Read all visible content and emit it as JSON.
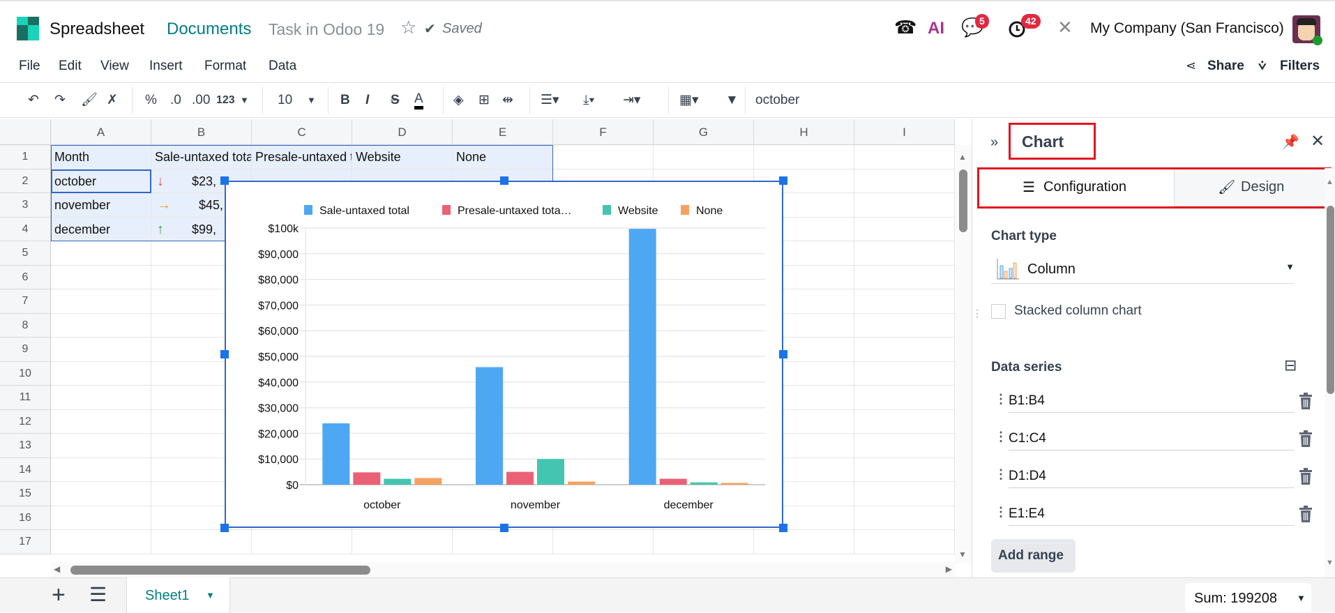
{
  "header": {
    "app_name": "Spreadsheet",
    "breadcrumb_documents": "Documents",
    "document_title": "Task in Odoo 19",
    "saved_status": "Saved",
    "messages_badge": "5",
    "activities_badge": "42",
    "ai_label": "AI",
    "company": "My Company (San Francisco)"
  },
  "menu": {
    "items": [
      "File",
      "Edit",
      "View",
      "Insert",
      "Format",
      "Data"
    ],
    "share": "Share",
    "filters": "Filters"
  },
  "toolbar": {
    "percent": "%",
    "dec_less": ".0",
    "dec_more": ".00",
    "format": "123",
    "font_size": "10",
    "bold": "B",
    "italic": "I",
    "strike": "S",
    "text_color": "A",
    "filter_value": "october"
  },
  "grid": {
    "columns": [
      "A",
      "B",
      "C",
      "D",
      "E",
      "F",
      "G",
      "H",
      "I"
    ],
    "rows": [
      "1",
      "2",
      "3",
      "4",
      "5",
      "6",
      "7",
      "8",
      "9",
      "10",
      "11",
      "12",
      "13",
      "14",
      "15",
      "16",
      "17"
    ],
    "header_row": [
      "Month",
      "Sale-untaxed total",
      "Presale-untaxed total",
      "Website",
      "None"
    ],
    "months": [
      "october",
      "november",
      "december"
    ],
    "b_values": [
      "$23,",
      "$45,",
      "$99,"
    ],
    "trend_icons": [
      "arrow-down",
      "arrow-right",
      "arrow-up"
    ]
  },
  "chart_data": {
    "type": "bar",
    "categories": [
      "october",
      "november",
      "december"
    ],
    "series": [
      {
        "name": "Sale-untaxed total",
        "legend": "Sale-untaxed total",
        "color": "#4ea7f2",
        "values": [
          23900,
          45800,
          99700
        ]
      },
      {
        "name": "Presale-untaxed total",
        "legend": "Presale-untaxed tota…",
        "color": "#ea6175",
        "values": [
          4800,
          5000,
          2300
        ]
      },
      {
        "name": "Website",
        "legend": "Website",
        "color": "#43c5b1",
        "values": [
          2300,
          10000,
          900
        ]
      },
      {
        "name": "None",
        "legend": "None",
        "color": "#f4a261",
        "values": [
          2600,
          1200,
          700
        ]
      }
    ],
    "ylim": [
      0,
      100000
    ],
    "yticks": [
      "$0",
      "$10,000",
      "$20,000",
      "$30,000",
      "$40,000",
      "$50,000",
      "$60,000",
      "$70,000",
      "$80,000",
      "$90,000",
      "$100k"
    ],
    "legend_position": "top",
    "grid": true
  },
  "panel": {
    "title": "Chart",
    "tabs": [
      "Configuration",
      "Design"
    ],
    "chart_type_label": "Chart type",
    "chart_type_value": "Column",
    "stacked_label": "Stacked column chart",
    "stacked_checked": false,
    "data_series_label": "Data series",
    "ranges": [
      "B1:B4",
      "C1:C4",
      "D1:D4",
      "E1:E4"
    ],
    "add_range": "Add range"
  },
  "bottom": {
    "sheet_name": "Sheet1",
    "sum": "Sum: 199208"
  }
}
